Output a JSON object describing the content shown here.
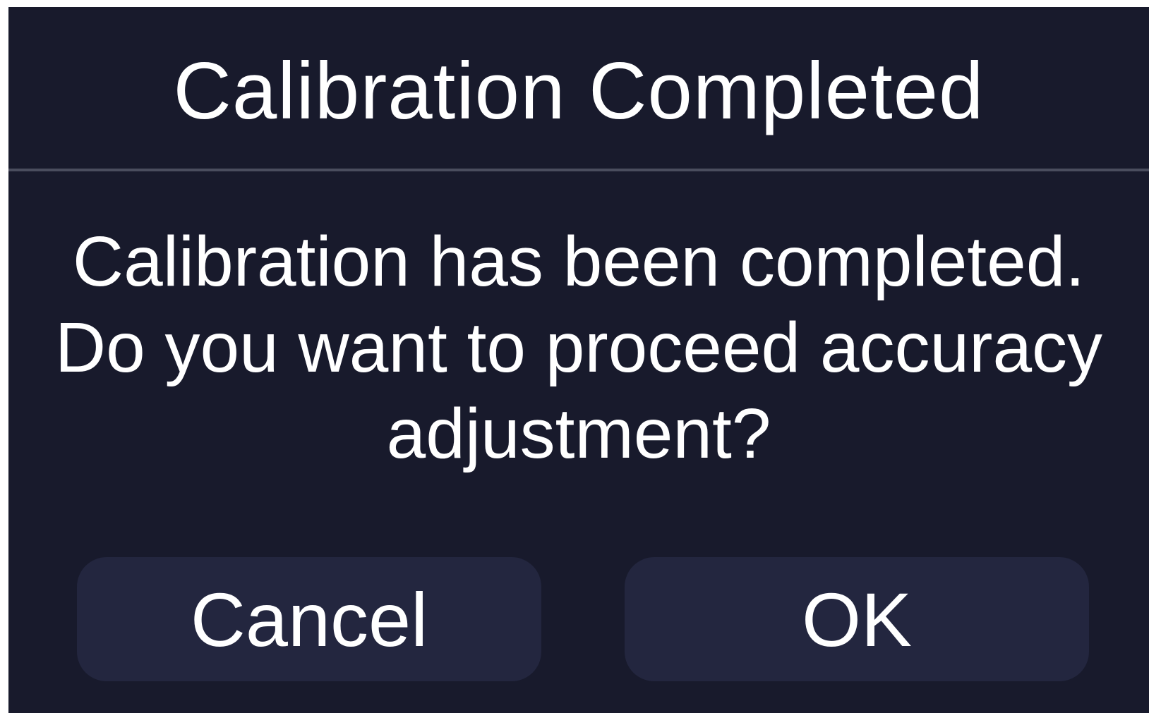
{
  "dialog": {
    "title": "Calibration Completed",
    "message_lines": [
      "Calibration has been completed.",
      "Do you want to proceed accuracy",
      "adjustment?"
    ],
    "buttons": {
      "cancel_label": "Cancel",
      "ok_label": "OK"
    }
  },
  "colors": {
    "background": "#181a2c",
    "button": "#23263f",
    "divider": "#4a4d5e",
    "text": "#ffffff"
  }
}
